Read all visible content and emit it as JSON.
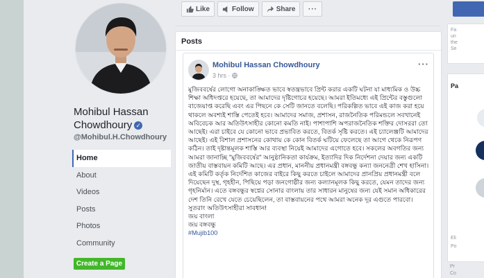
{
  "profile": {
    "name": "Mohibul Hassan Chowdhoury",
    "handle": "@Mohibul.H.Chowdhoury",
    "verified_mark": "✓"
  },
  "nav": {
    "items": [
      {
        "label": "Home",
        "active": true
      },
      {
        "label": "About"
      },
      {
        "label": "Videos"
      },
      {
        "label": "Posts"
      },
      {
        "label": "Photos"
      },
      {
        "label": "Community"
      }
    ],
    "cta_label": "Create a Page"
  },
  "actions": {
    "like": "Like",
    "follow": "Follow",
    "share": "Share",
    "more": "···"
  },
  "posts": {
    "title": "Posts",
    "story": {
      "author": "Mohibul Hassan Chowdhoury",
      "time": "3 hrs ·",
      "more": "···",
      "body": "মুজিববর্ষের লোগো অনাকাঙ্ক্ষিত ভাবে স্বতন্ত্রভাবে প্রিন্ট করার একটি ঘটনা যা মাধ্যমিক ও উচ্চ শিক্ষা অধিদপ্তরে হয়েছে, তা আমাদের দৃষ্টিগোচর হয়েছে। আমরা ইতিমধ্যে এই প্রিন্টের বস্তুগুলো বাজেয়াপ্ত করেছি এবং এর পিছনে কে সেটি জানতে বলেছি। পরিকল্পিত ভাবে এই কাজ করা হয়ে থাকলে অবশ্যই শাস্তি পেতেই হবে। আমাদের সমাজ, প্রশাসন, রাজনৈতিক পরিমন্ডলে সবখানেই অবিবেচক আর অতিউৎসাহীর কোনো কমতি নাই। পাশাপাশি অপরাজনৈতিক শক্তির দোসররা তো আছেই। এরা চাইবে যে কোনো ভাবে প্রভাবিত করতে, বিতর্ক সৃষ্টি করতে। এই চ্যালেঞ্জটি আমাদের আছেই। এই বিশাল প্রশাসনের কোথায় কে কোন বিতর্ক ঘটিয়ে ফেলেছে তা আগে থেকে নিরূপণ কঠিন। তাই দৃষ্টান্তমূলক শাস্তি আর ব্যবস্থা নিয়েই আমাদের এগোতে হবে। সকলের অবগতির জন্য আমরা জানাচ্ছি \"মুজিববর্ষের\" আনুষ্ঠানিকতা কার্যক্রম, ইত্যাদির দিক নির্দেশনা দেয়ার জন্য একটি জাতীয় বাস্তবায়ন কমিটি আছে। এর প্রধান, মাননীয় প্রধানমন্ত্রী বঙ্গবন্ধু কন্যা জননেত্রী শেখ হাসিনা। এই কমিটি কর্তৃক নির্দেশিত কাজের বাইরে কিছু করতে চাইলে আমাদের প্রানপ্রিয় প্রধানমন্ত্রী বলে দিয়েছেন দুস্থ, গৃহহীন, পিছিয়ে পড়া জনগোষ্ঠীর জন্য কল্যানমূলক কিছু করতে, যেমন তাদের জন্য গৃহনির্মান। এতে বঙ্গবন্ধুর স্বপ্নের সোনার বাংলায় তার সাধারন মানুষের জন্য যেই সমান অধিকারের দেশ তিনি রেখে যেতে চেয়েছিলেন, তা বাস্তবায়নের পথে আমরা অনেক দূর এগুতে পারবো। সুতরাং অতিউৎসাহীরা সাবধান!",
      "line2": "জয় বাংলা",
      "line3": "জয় বঙ্গবন্ধু",
      "hashtag": "#Mujib100"
    }
  },
  "right": {
    "snippets": [
      "Fa",
      "un",
      "the",
      "Se"
    ],
    "section": "Pa",
    "lower": [
      "Eli",
      "Po"
    ],
    "bottom": [
      "Pr",
      "Co"
    ]
  },
  "colors": {
    "brand": "#4267b2",
    "link": "#365899",
    "cta": "#42b72a"
  },
  "icons": [
    "like-icon",
    "follow-icon",
    "share-icon",
    "globe-icon",
    "verified-icon"
  ]
}
